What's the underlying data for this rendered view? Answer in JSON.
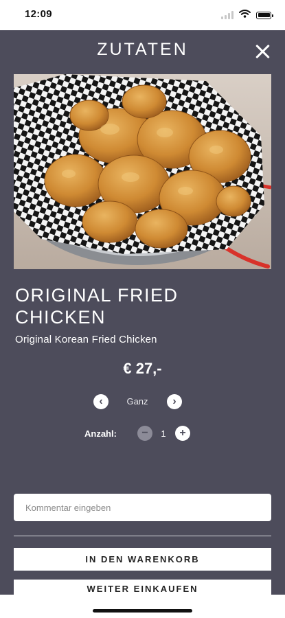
{
  "status_bar": {
    "time": "12:09",
    "icons": [
      "signal-icon",
      "wifi-icon",
      "battery-icon"
    ]
  },
  "header": {
    "title": "ZUTATEN",
    "close_icon": "close-icon"
  },
  "product": {
    "name": "ORIGINAL  FRIED CHICKEN",
    "description": "Original Korean Fried Chicken",
    "price": "€ 27,-"
  },
  "variant": {
    "selected": "Ganz",
    "prev_icon": "chevron-left-icon",
    "next_icon": "chevron-right-icon"
  },
  "quantity": {
    "label": "Anzahl:",
    "value": "1",
    "minus_icon": "minus-icon",
    "plus_icon": "plus-icon"
  },
  "comment": {
    "placeholder": "Kommentar eingeben"
  },
  "actions": {
    "add_to_cart": "IN DEN WARENKORB",
    "continue_shopping": "WEITER EINKAUFEN"
  },
  "colors": {
    "panel_background": "#4d4c5b",
    "text": "#ffffff",
    "button_background": "#ffffff"
  }
}
